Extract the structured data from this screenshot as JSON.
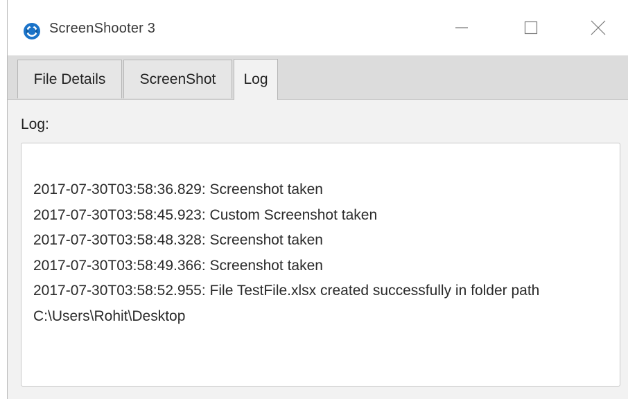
{
  "window": {
    "title": "ScreenShooter 3",
    "icons": {
      "app": "screenshooter-app-icon",
      "minimize": "minimize-icon",
      "maximize": "maximize-icon",
      "close": "close-icon"
    },
    "accent_color": "#1a73c9"
  },
  "tabs": [
    {
      "label": "File Details",
      "active": false
    },
    {
      "label": "ScreenShot",
      "active": false
    },
    {
      "label": "Log",
      "active": true
    }
  ],
  "log": {
    "label": "Log:",
    "entries": [
      "2017-07-30T03:58:36.829: Screenshot taken",
      "2017-07-30T03:58:45.923: Custom Screenshot taken",
      "2017-07-30T03:58:48.328: Screenshot taken",
      "2017-07-30T03:58:49.366: Screenshot taken",
      "2017-07-30T03:58:52.955: File TestFile.xlsx created successfully in folder path C:\\Users\\Rohit\\Desktop"
    ]
  }
}
